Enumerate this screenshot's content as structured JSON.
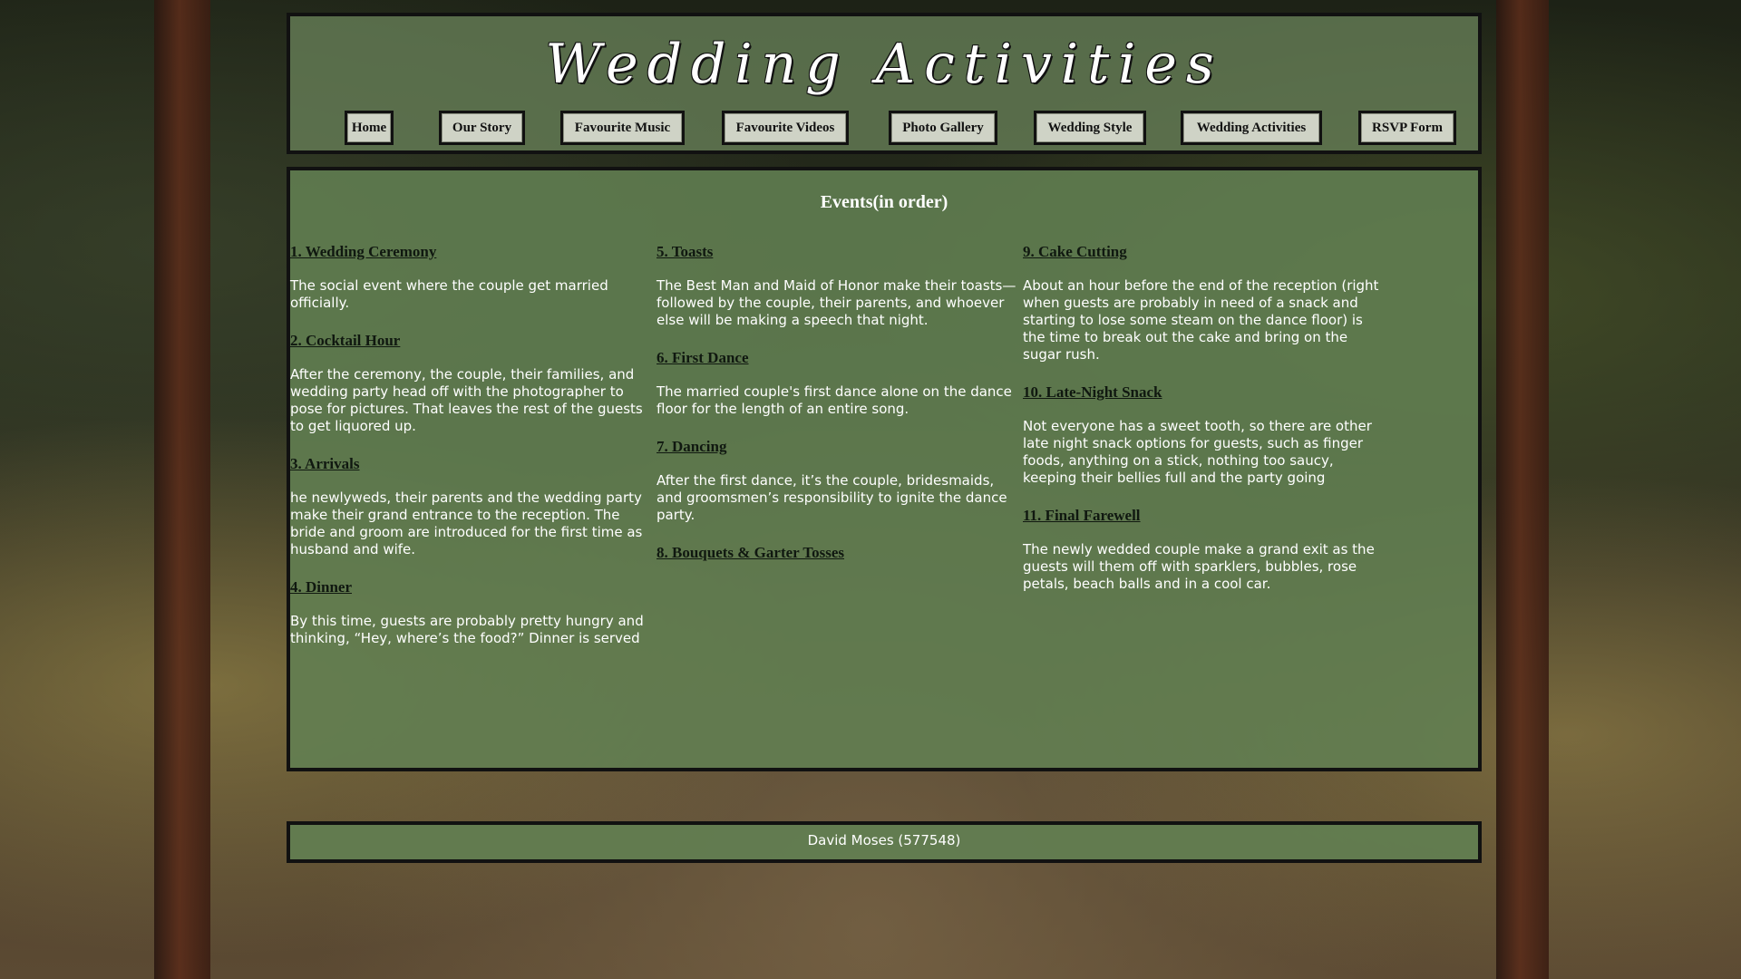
{
  "header": {
    "title": "Wedding Activities"
  },
  "nav": {
    "items": [
      {
        "label": "Home"
      },
      {
        "label": "Our Story"
      },
      {
        "label": "Favourite Music"
      },
      {
        "label": "Favourite Videos"
      },
      {
        "label": "Photo Gallery"
      },
      {
        "label": "Wedding Style"
      },
      {
        "label": "Wedding Activities"
      },
      {
        "label": "RSVP Form"
      }
    ]
  },
  "main": {
    "heading": "Events(in order)",
    "events": [
      {
        "title": "1. Wedding Ceremony",
        "desc": "The social event where the couple get married officially."
      },
      {
        "title": "2. Cocktail Hour",
        "desc": "After the ceremony, the couple, their families, and wedding party head off with the photographer to pose for pictures. That leaves the rest of the guests to get liquored up."
      },
      {
        "title": "3. Arrivals",
        "desc": "he newlyweds, their parents and the wedding party make their grand entrance to the reception. The bride and groom are introduced for the first time as husband and wife."
      },
      {
        "title": "4. Dinner",
        "desc": "By this time, guests are probably pretty hungry and thinking, “Hey, where’s the food?” Dinner is served"
      },
      {
        "title": "5. Toasts",
        "desc": "The Best Man and Maid of Honor make their toasts—followed by the couple, their parents, and whoever else will be making a speech that night."
      },
      {
        "title": "6. First Dance",
        "desc": "The married couple's first dance alone on the dance floor for the length of an entire song."
      },
      {
        "title": "7. Dancing",
        "desc": "After the first dance, it’s the couple, bridesmaids, and groomsmen’s responsibility to ignite the dance party."
      },
      {
        "title": "8. Bouquets & Garter Tosses",
        "desc": ""
      },
      {
        "title": "9. Cake Cutting",
        "desc": "About an hour before the end of the reception (right when guests are probably in need of a snack and starting to lose some steam on the dance floor) is the time to break out the cake and bring on the sugar rush."
      },
      {
        "title": "10. Late-Night Snack",
        "desc": "Not everyone has a sweet tooth, so there are other late night snack options for guests, such as finger foods, anything on a stick, nothing too saucy, keeping their bellies full and the party going"
      },
      {
        "title": "11. Final Farewell",
        "desc": "The newly wedded couple make a grand exit as the guests will them off with sparklers, bubbles, rose petals, beach balls and in a cool car."
      }
    ]
  },
  "footer": {
    "text": "David Moses (577548)"
  }
}
